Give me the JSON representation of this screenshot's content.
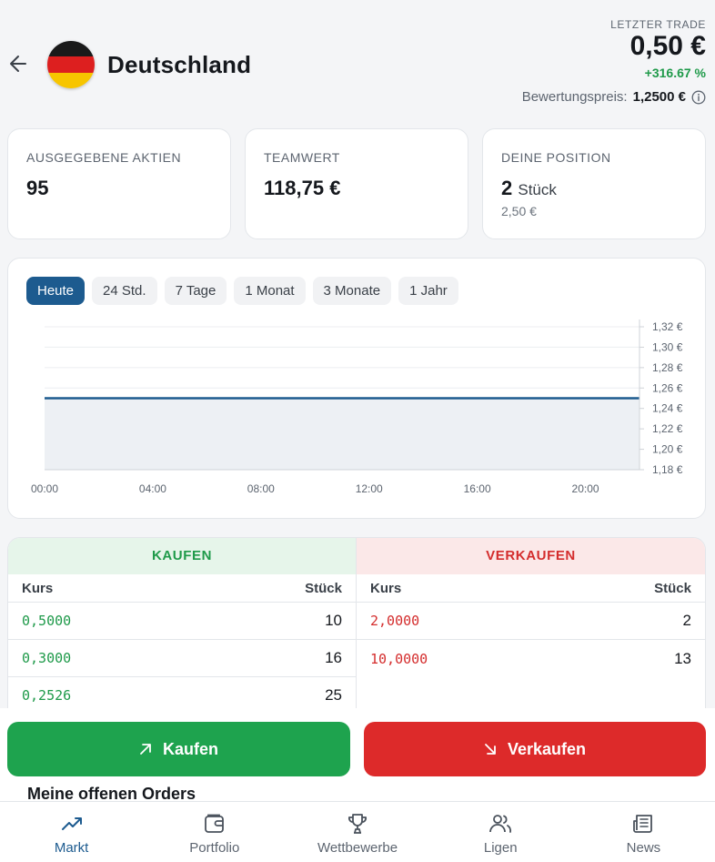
{
  "header": {
    "team_name": "Deutschland",
    "last_trade_label": "LETZTER TRADE",
    "last_trade_price": "0,50 €",
    "change": "+316.67 %",
    "valuation_label": "Bewertungspreis:",
    "valuation_value": "1,2500 €",
    "back_icon": "arrow-left-icon",
    "flag_colors": [
      "#1a1a1a",
      "#dd1f1f",
      "#f7c500"
    ]
  },
  "stats": [
    {
      "label": "AUSGEGEBENE AKTIEN",
      "value": "95"
    },
    {
      "label": "TEAMWERT",
      "value": "118,75 €"
    },
    {
      "label": "DEINE POSITION",
      "value": "2",
      "unit": "Stück",
      "sub": "2,50 €"
    }
  ],
  "chart": {
    "tabs": [
      "Heute",
      "24 Std.",
      "7 Tage",
      "1 Monat",
      "3 Monate",
      "1 Jahr"
    ],
    "active_tab": "Heute"
  },
  "chart_data": {
    "type": "area",
    "title": "",
    "xlabel": "",
    "ylabel": "",
    "x_ticks": [
      "00:00",
      "04:00",
      "08:00",
      "12:00",
      "16:00",
      "20:00"
    ],
    "y_ticks": [
      "1,32 €",
      "1,30 €",
      "1,28 €",
      "1,26 €",
      "1,24 €",
      "1,22 €",
      "1,20 €",
      "1,18 €"
    ],
    "ylim": [
      1.18,
      1.32
    ],
    "xlim": [
      "00:00",
      "22:00"
    ],
    "series": [
      {
        "x": [
          "00:00",
          "02:00",
          "04:00",
          "08:00",
          "12:00",
          "16:00",
          "20:00",
          "22:00"
        ],
        "values": [
          1.25,
          1.25,
          1.25,
          1.25,
          1.25,
          1.25,
          1.25,
          1.25
        ]
      }
    ],
    "grid": true,
    "y_axis_position": "right",
    "colors": {
      "line": "#1d5b8f",
      "fill": "#edf0f4"
    }
  },
  "orderbook": {
    "buy_title": "KAUFEN",
    "sell_title": "VERKAUFEN",
    "col_price": "Kurs",
    "col_qty": "Stück",
    "buy": [
      {
        "price": "0,5000",
        "qty": "10"
      },
      {
        "price": "0,3000",
        "qty": "16"
      },
      {
        "price": "0,2526",
        "qty": "25"
      }
    ],
    "sell": [
      {
        "price": "2,0000",
        "qty": "2"
      },
      {
        "price": "10,0000",
        "qty": "13"
      }
    ]
  },
  "actions": {
    "buy_label": "Kaufen",
    "sell_label": "Verkaufen",
    "buy_color": "#1ea34e",
    "sell_color": "#dd2a2a"
  },
  "open_orders_title": "Meine offenen Orders",
  "nav": [
    {
      "label": "Markt",
      "icon": "trending-up-icon",
      "active": true
    },
    {
      "label": "Portfolio",
      "icon": "wallet-icon",
      "active": false
    },
    {
      "label": "Wettbewerbe",
      "icon": "trophy-icon",
      "active": false
    },
    {
      "label": "Ligen",
      "icon": "users-icon",
      "active": false
    },
    {
      "label": "News",
      "icon": "newspaper-icon",
      "active": false
    }
  ]
}
